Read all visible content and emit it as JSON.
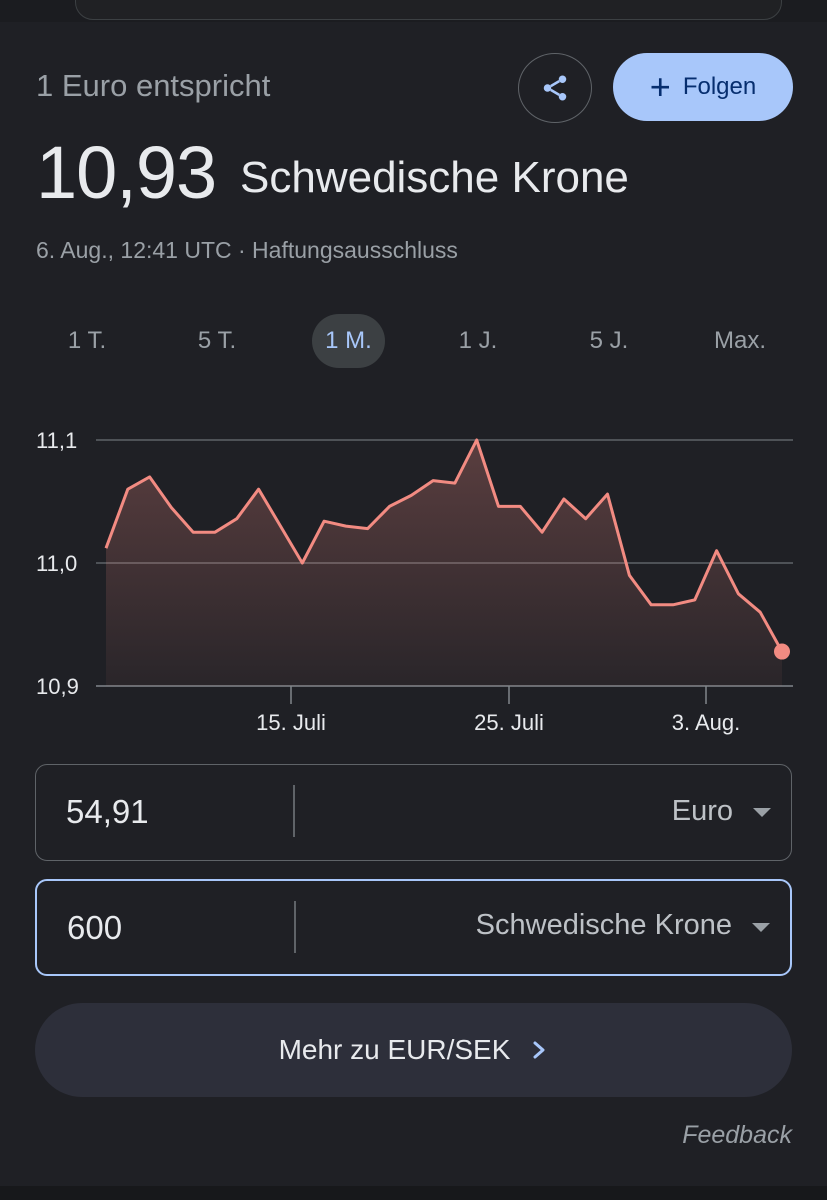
{
  "header": {
    "subtitle": "1 Euro entspricht",
    "rate_value": "10,93",
    "rate_currency": "Schwedische Krone",
    "meta": "6. Aug., 12:41 UTC · Haftungsausschluss",
    "follow_label": "Folgen",
    "share_icon": "share-icon",
    "follow_icon": "plus-icon"
  },
  "range_tabs": [
    {
      "label": "1 T.",
      "active": false
    },
    {
      "label": "5 T.",
      "active": false
    },
    {
      "label": "1 M.",
      "active": true
    },
    {
      "label": "1 J.",
      "active": false
    },
    {
      "label": "5 J.",
      "active": false
    },
    {
      "label": "Max.",
      "active": false
    }
  ],
  "chart_data": {
    "type": "area",
    "series": [
      {
        "values": [
          11.012,
          11.06,
          11.07,
          11.045,
          11.025,
          11.025,
          11.036,
          11.06,
          11.03,
          11.0,
          11.034,
          11.03,
          11.028,
          11.046,
          11.055,
          11.067,
          11.065,
          11.1,
          11.046,
          11.046,
          11.025,
          11.052,
          11.036,
          11.056,
          10.99,
          10.966,
          10.966,
          10.97,
          11.01,
          10.975,
          10.96,
          10.928
        ]
      }
    ],
    "x_labels": [
      "15. Juli",
      "25. Juli",
      "3. Aug."
    ],
    "y_ticks": [
      11.1,
      11.0,
      10.9
    ],
    "y_tick_labels": [
      "11,1",
      "11,0",
      "10,9"
    ],
    "ylim": [
      10.9,
      11.1
    ],
    "grid": true,
    "line_color": "#f28b82",
    "fill_color": "#f28b82"
  },
  "converter": {
    "from": {
      "amount": "54,91",
      "currency": "Euro"
    },
    "to": {
      "amount": "600",
      "currency": "Schwedische Krone"
    }
  },
  "more_button": {
    "label": "Mehr zu EUR/SEK",
    "icon": "chevron-right-icon"
  },
  "feedback_label": "Feedback",
  "colors": {
    "background": "#1f2025",
    "accent": "#a8c7fa",
    "chart_line": "#f28b82"
  }
}
